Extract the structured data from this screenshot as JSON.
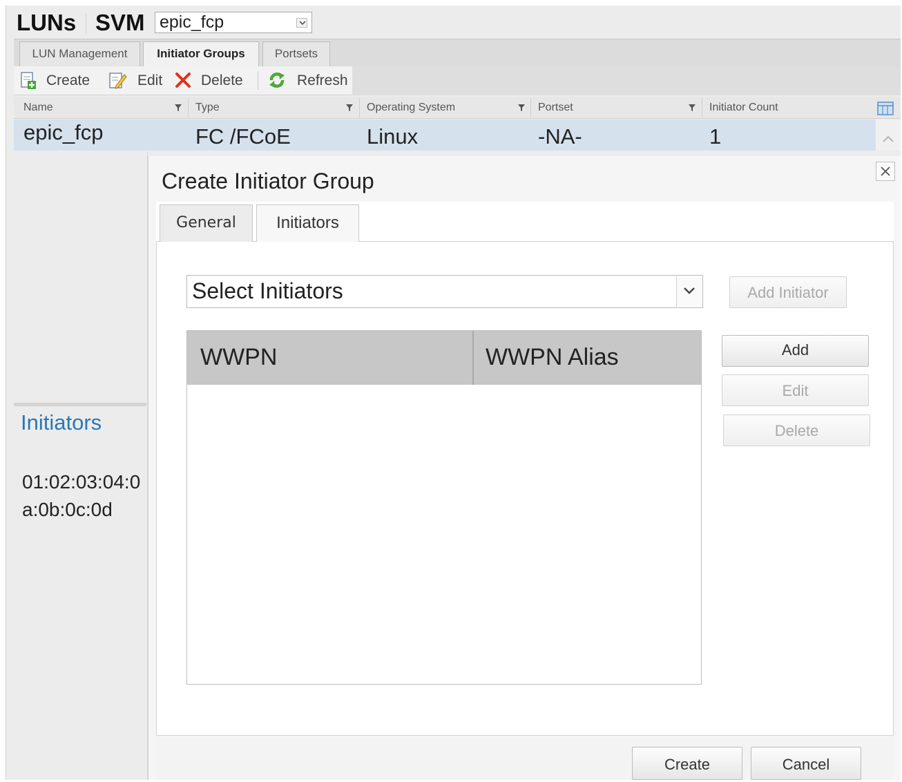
{
  "header": {
    "title": "LUNs",
    "svm_label": "SVM",
    "svm_selected": "epic_fcp"
  },
  "tabs": [
    {
      "label": "LUN Management",
      "active": false
    },
    {
      "label": "Initiator Groups",
      "active": true
    },
    {
      "label": "Portsets",
      "active": false
    }
  ],
  "toolbar": {
    "create_label": "Create",
    "edit_label": "Edit",
    "delete_label": "Delete",
    "refresh_label": "Refresh"
  },
  "grid": {
    "columns": [
      "Name",
      "Type",
      "Operating System",
      "Portset",
      "Initiator Count"
    ],
    "rows": [
      [
        "epic_fcp",
        "FC /FCoE",
        "Linux",
        "-NA-",
        "1"
      ]
    ]
  },
  "details": {
    "title": "Initiators",
    "value": "01:02:03:04:0a:0b:0c:0d"
  },
  "dialog": {
    "title": "Create Initiator Group",
    "tabs": [
      {
        "label": "General",
        "active": false
      },
      {
        "label": "Initiators",
        "active": true
      }
    ],
    "initiator_select": "Select Initiators",
    "add_initiator_label": "Add Initiator",
    "table_columns": [
      "WWPN",
      "WWPN Alias"
    ],
    "add_label": "Add",
    "edit_label": "Edit",
    "delete_label": "Delete",
    "create_label": "Create",
    "cancel_label": "Cancel"
  },
  "colors": {
    "accent_blue": "#2a78b6",
    "selected_row": "#d6e1ee",
    "delete_red": "#e0311c",
    "refresh_green": "#4ea83a"
  }
}
